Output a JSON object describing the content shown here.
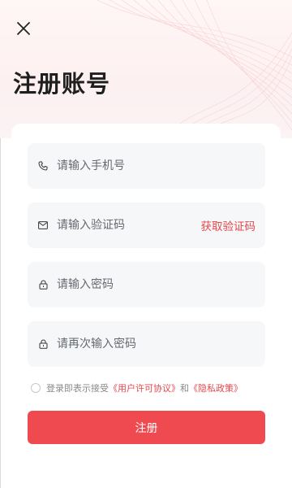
{
  "header": {
    "title": "注册账号",
    "close_icon": "close-icon"
  },
  "form": {
    "phone": {
      "placeholder": "请输入手机号",
      "value": "",
      "icon": "phone-icon"
    },
    "code": {
      "placeholder": "请输入验证码",
      "value": "",
      "icon": "mail-icon",
      "get_code_label": "获取验证码"
    },
    "password": {
      "placeholder": "请输入密码",
      "value": "",
      "icon": "lock-icon"
    },
    "confirm_password": {
      "placeholder": "请再次输入密码",
      "value": "",
      "icon": "lock-icon"
    }
  },
  "agreement": {
    "checked": false,
    "prefix": "登录即表示接受",
    "user_agreement": "《用户许可协议》",
    "and": "和",
    "privacy_policy": "《隐私政策》"
  },
  "submit_label": "注册",
  "colors": {
    "accent": "#ef4a4f",
    "link": "#e5484d",
    "field_bg": "#f6f7f8"
  }
}
